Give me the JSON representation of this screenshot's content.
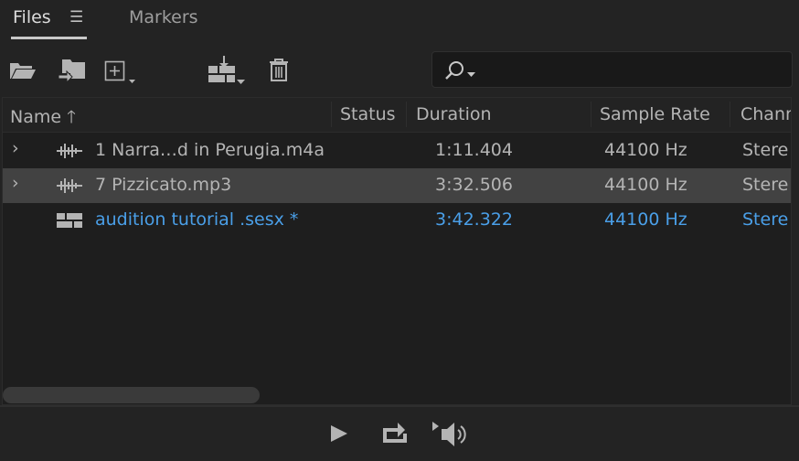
{
  "tabs": [
    {
      "label": "Files",
      "active": true
    },
    {
      "label": "Markers",
      "active": false
    }
  ],
  "toolbar": {
    "icons": [
      "open-folder-icon",
      "import-icon",
      "new-file-icon",
      "insert-into-multitrack-icon",
      "delete-icon"
    ]
  },
  "search": {
    "value": "",
    "placeholder": ""
  },
  "columns": [
    "Name",
    "Status",
    "Duration",
    "Sample Rate",
    "Chann"
  ],
  "sort": {
    "column": "Name",
    "direction": "ascending"
  },
  "rows": [
    {
      "name": "1 Narra…d in Perugia.m4a",
      "status": "",
      "duration": "1:11.404",
      "sample_rate": "44100 Hz",
      "channels": "Stere",
      "type": "audio",
      "expandable": true,
      "selected": false
    },
    {
      "name": "7 Pizzicato.mp3",
      "status": "",
      "duration": "3:32.506",
      "sample_rate": "44100 Hz",
      "channels": "Stere",
      "type": "audio",
      "expandable": true,
      "selected": true
    },
    {
      "name": "audition tutorial .sesx *",
      "status": "",
      "duration": "3:42.322",
      "sample_rate": "44100 Hz",
      "channels": "Stere",
      "type": "multitrack",
      "expandable": false,
      "selected": false,
      "active": true
    }
  ],
  "colors": {
    "background": "#232323",
    "list": "#1e1e1e",
    "selected_row": "#424242",
    "active_text": "#4a9fe8",
    "text": "#b4b4b4"
  },
  "playback": {
    "icons": [
      "play-icon",
      "loop-icon",
      "autoplay-volume-icon"
    ]
  }
}
